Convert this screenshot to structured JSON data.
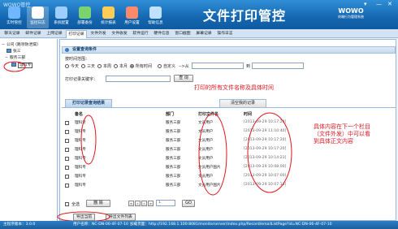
{
  "window": {
    "app_name": "WOWO管控",
    "controls": [
      "▾",
      "—",
      "✕"
    ]
  },
  "toolbar": {
    "items": [
      {
        "label": "实时管控",
        "icon": "monitor-icon",
        "color": "#6fb7ff"
      },
      {
        "label": "监控日志",
        "icon": "log-icon",
        "color": "#ffffff"
      },
      {
        "label": "系统配置",
        "icon": "settings-icon",
        "color": "#9ccfff"
      },
      {
        "label": "部署备份",
        "icon": "backup-icon",
        "color": "#7bd36f"
      },
      {
        "label": "统计报表",
        "icon": "report-icon",
        "color": "#ffcc55"
      },
      {
        "label": "用户设置",
        "icon": "users-icon",
        "color": "#ff8a6b"
      },
      {
        "label": "帮助信息",
        "icon": "help-icon",
        "color": "#c0e1ff"
      }
    ],
    "active_index": 1
  },
  "banner": {
    "title": "文件打印管控",
    "logo_main": "WOWO",
    "logo_sub": "终端行为管理系统"
  },
  "tabs": [
    "聊天记录",
    "邮件记录",
    "上网记录",
    "打印记录",
    "文件外发",
    "文件收发",
    "软件运行",
    "硬件信息",
    "窗口截图",
    "屏幕记录",
    "操作日志"
  ],
  "active_tab": 3,
  "tree": {
    "root": "公司 (路领防泄漏)",
    "children": [
      "张三",
      "服务三部"
    ],
    "leaf": "理科专"
  },
  "query": {
    "section_title": "设置查询条件",
    "time_range_label": "按时间范围：",
    "time_options": [
      "今天",
      "三天",
      "本周",
      "本月",
      "所有时间",
      "自定义"
    ],
    "time_selected": 4,
    "custom_arrow": "-->从",
    "to_label": "到",
    "keyword_label": "打印记录关键字：",
    "keyword_value": "",
    "query_button": "查 询"
  },
  "annotations": {
    "note_1": "打印的所有文件名称及具体时间",
    "note_2": "具体内容在下一个栏目\n（文件外发）中可以看\n到具体正文内容"
  },
  "results": {
    "tab_active": "打印记录查询结果",
    "tab_other": "清空我的记录",
    "columns": [
      "备名",
      "部门",
      "打印文件名",
      "时间"
    ],
    "rows": [
      {
        "name": "理科专",
        "dept": "服务三部",
        "file": "文员用户",
        "time": "[2013-09-29 10:17:24]"
      },
      {
        "name": "理科专",
        "dept": "服务三部",
        "file": "文员用户",
        "time": "[2013-09-29 11:10:40]"
      },
      {
        "name": "理科专",
        "dept": "服务三部",
        "file": "文员用户",
        "time": "[2013-09-29 10:17:20]"
      },
      {
        "name": "理科专",
        "dept": "服务三部",
        "file": "文员用户",
        "time": "[2013-09-29 10:17:20]"
      },
      {
        "name": "理科专",
        "dept": "服务三部",
        "file": "文员用户",
        "time": "[2013-09-29 10:14:23]"
      },
      {
        "name": "理科专",
        "dept": "服务三部",
        "file": "文员用户图片",
        "time": "[2013-09-29 10:08:00]"
      },
      {
        "name": "理科专",
        "dept": "服务三部",
        "file": "文员用户",
        "time": "[2013-09-29 10:07:00]"
      },
      {
        "name": "理科专",
        "dept": "服务三部",
        "file": "文员用户图片",
        "time": "[2013-09-29 10:07:13]"
      }
    ],
    "select_all": "全选",
    "delete": "删 除",
    "page_value": "1",
    "go": "GO",
    "export_current": "导出当前",
    "export_all": "导出文件列表"
  },
  "status": {
    "version": "主程序版本：3.0.0",
    "user": "用户名称：NC-DN-06-4F-07-10",
    "load": "加载页面：http://192.168.1.100:8081/monitorserver/index.php/Record/emailListPage?id=NC-DN-06-4F-07-10"
  },
  "colors": {
    "title_blue": "#1567b0",
    "annotation_red": "#e0141c",
    "panel_border": "#9bb9d8"
  }
}
